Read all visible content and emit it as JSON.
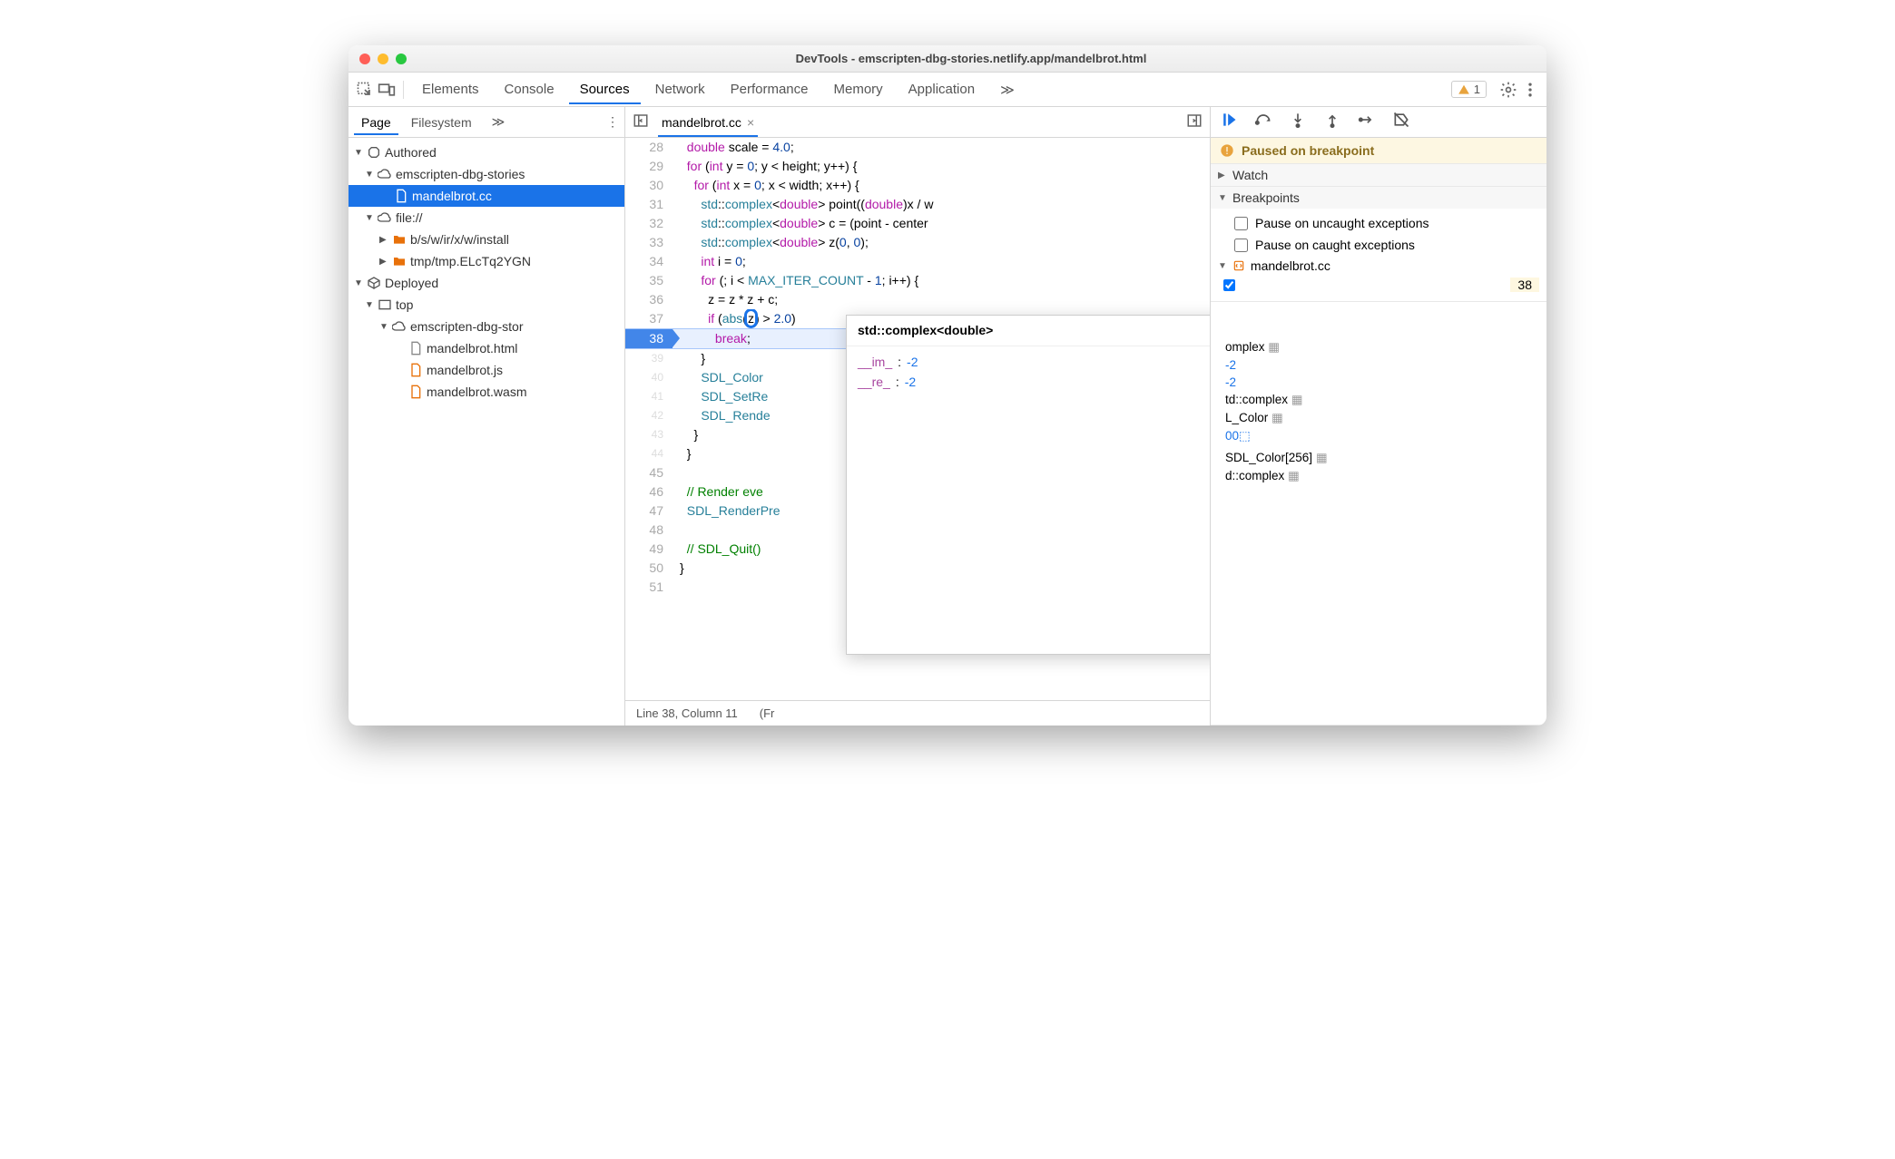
{
  "window": {
    "title": "DevTools - emscripten-dbg-stories.netlify.app/mandelbrot.html"
  },
  "top_tabs": {
    "items": [
      "Elements",
      "Console",
      "Sources",
      "Network",
      "Performance",
      "Memory",
      "Application"
    ],
    "active": "Sources",
    "overflow": "≫",
    "warn_count": "1"
  },
  "left": {
    "subtabs": [
      "Page",
      "Filesystem"
    ],
    "active": "Page",
    "overflow": "≫",
    "tree": {
      "authored_label": "Authored",
      "proj1": "emscripten-dbg-stories",
      "proj1_file": "mandelbrot.cc",
      "file_scheme": "file://",
      "folder1": "b/s/w/ir/x/w/install",
      "folder2": "tmp/tmp.ELcTq2YGN",
      "deployed_label": "Deployed",
      "top_label": "top",
      "host_label": "emscripten-dbg-stor",
      "f_html": "mandelbrot.html",
      "f_js": "mandelbrot.js",
      "f_wasm": "mandelbrot.wasm"
    }
  },
  "center": {
    "tab": "mandelbrot.cc",
    "status": {
      "pos": "Line 38, Column 11",
      "extra": "(Fr"
    },
    "lines": [
      {
        "n": "28",
        "raw": "  double scale = 4.0;"
      },
      {
        "n": "29",
        "raw": "  for (int y = 0; y < height; y++) {"
      },
      {
        "n": "30",
        "raw": "    for (int x = 0; x < width; x++) {"
      },
      {
        "n": "31",
        "raw": "      std::complex<double> point((double)x / w"
      },
      {
        "n": "32",
        "raw": "      std::complex<double> c = (point - center"
      },
      {
        "n": "33",
        "raw": "      std::complex<double> z(0, 0);"
      },
      {
        "n": "34",
        "raw": "      int i = 0;"
      },
      {
        "n": "35",
        "raw": "      for (; i < MAX_ITER_COUNT - 1; i++) {"
      },
      {
        "n": "36",
        "raw": "        z = z * z + c;"
      },
      {
        "n": "37",
        "raw": "        if (abs(z) > 2.0)"
      },
      {
        "n": "38",
        "raw": "          break;"
      },
      {
        "n": "39",
        "raw": "      }"
      },
      {
        "n": "40",
        "raw": "      SDL_Color"
      },
      {
        "n": "41",
        "raw": "      SDL_SetRe"
      },
      {
        "n": "42",
        "raw": "      SDL_Rende"
      },
      {
        "n": "43",
        "raw": "    }"
      },
      {
        "n": "44",
        "raw": "  }"
      },
      {
        "n": "45",
        "raw": ""
      },
      {
        "n": "46",
        "raw": "  // Render eve"
      },
      {
        "n": "47",
        "raw": "  SDL_RenderPre"
      },
      {
        "n": "48",
        "raw": ""
      },
      {
        "n": "49",
        "raw": "  // SDL_Quit()"
      },
      {
        "n": "50",
        "raw": "}"
      },
      {
        "n": "51",
        "raw": ""
      }
    ],
    "popup": {
      "title": "std::complex<double>",
      "rows": [
        {
          "k": "__im_",
          "v": "-2"
        },
        {
          "k": "__re_",
          "v": "-2"
        }
      ]
    }
  },
  "right": {
    "paused": "Paused on breakpoint",
    "sections": {
      "watch": "Watch",
      "breakpoints": "Breakpoints",
      "bp_uncaught": "Pause on uncaught exceptions",
      "bp_caught": "Pause on caught exceptions",
      "bp_file": "mandelbrot.cc",
      "bp_linenum": "38"
    },
    "scope": [
      "omplex<double>⬚",
      "-2",
      "-2",
      "td::complex<double>⬚",
      "L_Color⬚",
      "00⬚",
      "",
      "SDL_Color[256]⬚",
      "d::complex<double>⬚"
    ]
  }
}
